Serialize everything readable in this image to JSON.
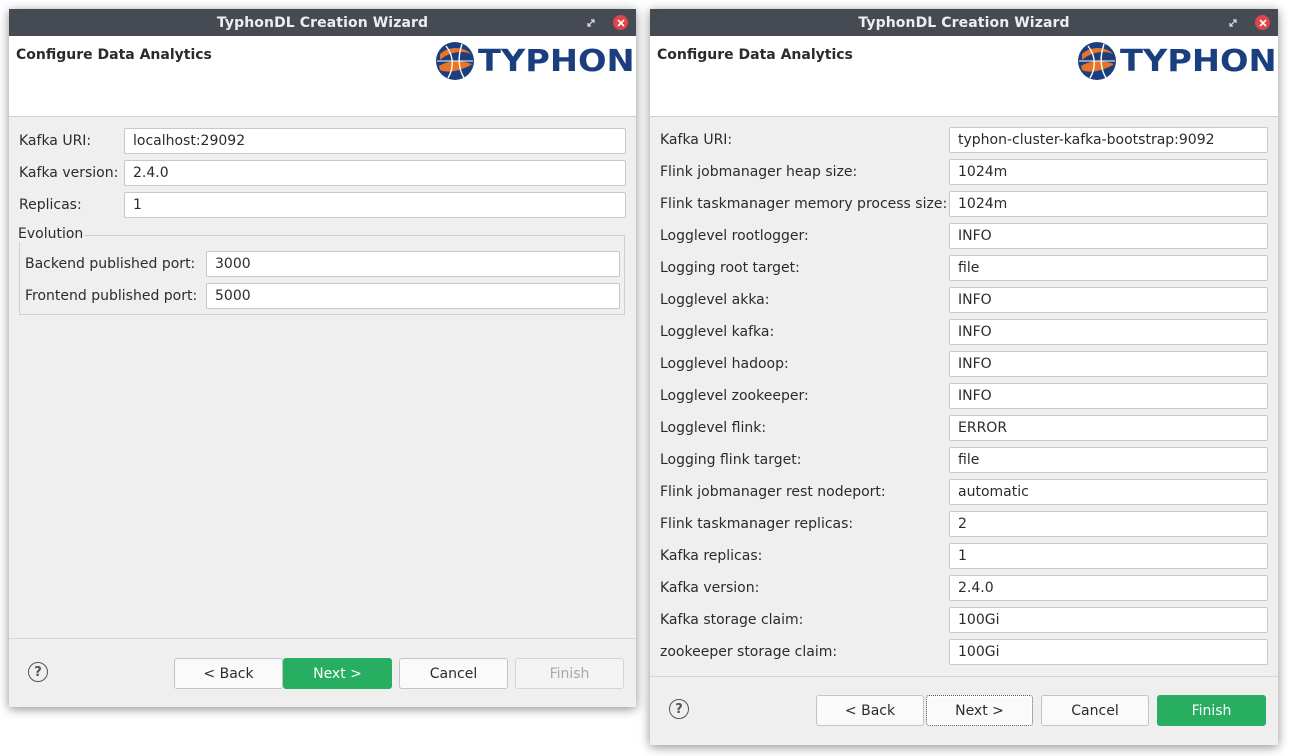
{
  "left_window": {
    "title": "TyphonDL Creation Wizard",
    "header_title": "Configure Data Analytics",
    "logo_text": "TYPHON",
    "fields": [
      {
        "label": "Kafka URI:",
        "value": "localhost:29092"
      },
      {
        "label": "Kafka version:",
        "value": "2.4.0"
      },
      {
        "label": "Replicas:",
        "value": "1"
      }
    ],
    "group": {
      "legend": "Evolution",
      "fields": [
        {
          "label": "Backend published port:",
          "value": "3000"
        },
        {
          "label": "Frontend published port:",
          "value": "5000"
        }
      ]
    },
    "buttons": {
      "help": "?",
      "back": "< Back",
      "next": "Next >",
      "cancel": "Cancel",
      "finish": "Finish"
    }
  },
  "right_window": {
    "title": "TyphonDL Creation Wizard",
    "header_title": "Configure Data Analytics",
    "logo_text": "TYPHON",
    "fields": [
      {
        "label": "Kafka URI:",
        "value": "typhon-cluster-kafka-bootstrap:9092"
      },
      {
        "label": "Flink jobmanager heap size:",
        "value": "1024m"
      },
      {
        "label": "Flink taskmanager memory process size:",
        "value": "1024m"
      },
      {
        "label": "Logglevel rootlogger:",
        "value": "INFO"
      },
      {
        "label": "Logging root target:",
        "value": "file"
      },
      {
        "label": "Logglevel akka:",
        "value": "INFO"
      },
      {
        "label": "Logglevel kafka:",
        "value": "INFO"
      },
      {
        "label": "Logglevel hadoop:",
        "value": "INFO"
      },
      {
        "label": "Logglevel zookeeper:",
        "value": "INFO"
      },
      {
        "label": "Logglevel flink:",
        "value": "ERROR"
      },
      {
        "label": "Logging flink target:",
        "value": "file"
      },
      {
        "label": "Flink jobmanager rest nodeport:",
        "value": "automatic"
      },
      {
        "label": "Flink taskmanager replicas:",
        "value": "2"
      },
      {
        "label": "Kafka replicas:",
        "value": "1"
      },
      {
        "label": "Kafka version:",
        "value": "2.4.0"
      },
      {
        "label": "Kafka storage claim:",
        "value": "100Gi"
      },
      {
        "label": "zookeeper storage claim:",
        "value": "100Gi"
      }
    ],
    "buttons": {
      "help": "?",
      "back": "< Back",
      "next": "Next >",
      "cancel": "Cancel",
      "finish": "Finish"
    }
  },
  "colors": {
    "titlebar": "#464b53",
    "primary_button": "#27ae60",
    "logo_blue": "#1b3e7e",
    "logo_orange": "#e8742a",
    "close_red": "#e0444b"
  }
}
